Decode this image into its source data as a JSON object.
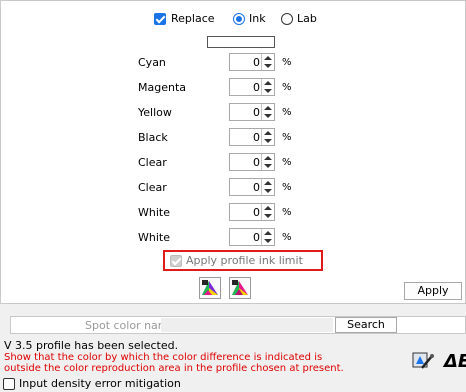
{
  "header": {
    "replace_label": "Replace",
    "replace_checked": true,
    "mode_options": [
      "Ink",
      "Lab"
    ],
    "mode_selected": "Ink"
  },
  "ink_rows": [
    {
      "name": "Cyan",
      "value": "0",
      "unit": "%"
    },
    {
      "name": "Magenta",
      "value": "0",
      "unit": "%"
    },
    {
      "name": "Yellow",
      "value": "0",
      "unit": "%"
    },
    {
      "name": "Black",
      "value": "0",
      "unit": "%"
    },
    {
      "name": "Clear",
      "value": "0",
      "unit": "%"
    },
    {
      "name": "Clear",
      "value": "0",
      "unit": "%"
    },
    {
      "name": "White",
      "value": "0",
      "unit": "%"
    },
    {
      "name": "White",
      "value": "0",
      "unit": "%"
    }
  ],
  "apply_limit": {
    "label": "Apply profile ink limit",
    "checked": true,
    "enabled": false
  },
  "apply_button": "Apply",
  "spot": {
    "label": "Spot color name",
    "value": "",
    "search_button": "Search"
  },
  "status": {
    "profile_message": "V 3.5 profile has been selected.",
    "warning": "Show that the color by which the color difference is indicated is outside the color reproduction area in the profile chosen at present.",
    "warning_line1": "Show that the color by which the color difference is indicated is",
    "warning_line2": "outside the color reproduction area in the profile chosen at present.",
    "delta_e_label": "ΔE"
  },
  "mitigation": {
    "label": "Input density error mitigation",
    "checked": false
  },
  "colors": {
    "accent": "#1a73e8",
    "highlight": "#e01b1b",
    "warning": "#e00000"
  },
  "icons": [
    "gamut-icon",
    "gamut-magenta-icon",
    "picker-icon",
    "delta-e-icon"
  ]
}
